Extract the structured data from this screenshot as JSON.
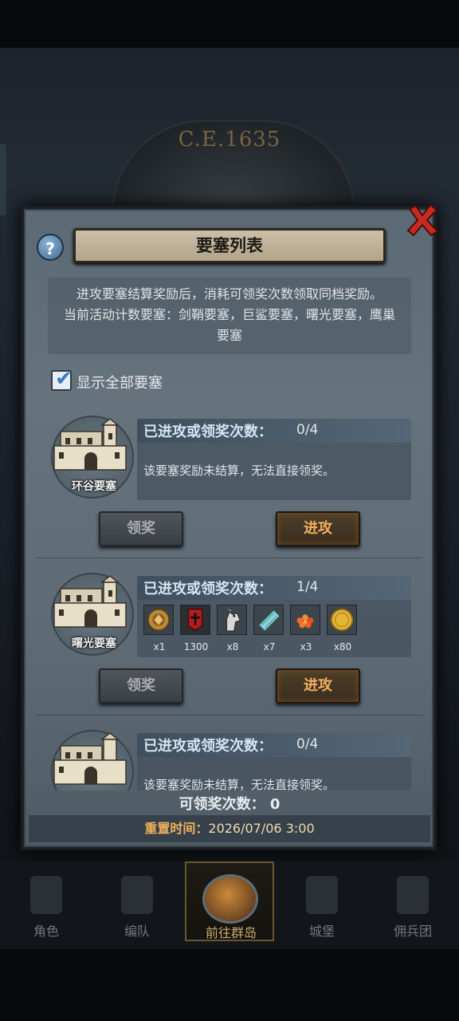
{
  "background": {
    "era": "C.E.1635"
  },
  "dialog": {
    "title": "要塞列表",
    "help_icon": "?",
    "description_lines": [
      "进攻要塞结算奖励后，消耗可领奖次数领取同档奖励。",
      "当前活动计数要塞：剑鞘要塞，巨鲨要塞，曙光要塞，鹰巢",
      "要塞"
    ],
    "show_all_label": "显示全部要塞",
    "show_all_checked": true,
    "fortresses": [
      {
        "name": "环谷要塞",
        "count_label": "已进攻或领奖次数：",
        "count": "0/4",
        "message": "该要塞奖励未结算，无法直接领奖。",
        "claim_label": "领奖",
        "attack_label": "进攻",
        "rewards": []
      },
      {
        "name": "曙光要塞",
        "count_label": "已进攻或领奖次数：",
        "count": "1/4",
        "message": "",
        "claim_label": "领奖",
        "attack_label": "进攻",
        "rewards": [
          {
            "icon": "medal-icon",
            "qty": "x1"
          },
          {
            "icon": "banner-icon",
            "qty": "1300"
          },
          {
            "icon": "horse-icon",
            "qty": "x8"
          },
          {
            "icon": "cloth-icon",
            "qty": "x7"
          },
          {
            "icon": "caviar-icon",
            "qty": "x3"
          },
          {
            "icon": "gold-coin-icon",
            "qty": "x80"
          }
        ]
      },
      {
        "name": "",
        "count_label": "已进攻或领奖次数：",
        "count": "0/4",
        "message": "该要塞奖励未结算，无法直接领奖。",
        "claim_label": "",
        "attack_label": "",
        "rewards": []
      }
    ],
    "claimable_label": "可领奖次数：",
    "claimable_value": "0",
    "reset_label": "重置时间：",
    "reset_value": "2026/07/06 3:00"
  },
  "nav": [
    {
      "label": "角色",
      "icon": "knight-icon",
      "active": false
    },
    {
      "label": "编队",
      "icon": "helmet-icon",
      "active": false
    },
    {
      "label": "前往群岛",
      "icon": "globe-icon",
      "active": true
    },
    {
      "label": "城堡",
      "icon": "castle-icon",
      "active": false
    },
    {
      "label": "佣兵团",
      "icon": "ship-icon",
      "active": false
    }
  ],
  "colors": {
    "accent": "#f0b060",
    "reset_key": "#f0b25a",
    "title_plate": "#c2b49b"
  }
}
